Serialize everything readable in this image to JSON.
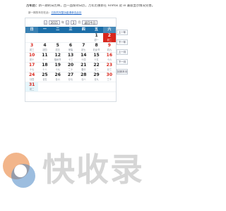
{
  "intro": {
    "bold": "万年历：",
    "text": "新一期的日历将，且一品保持日历，万年历重新在 Firefox 及 ie 兼容显示情况完善。"
  },
  "sub": {
    "prefix": "新一期的年历在此：",
    "link": "日历的完整功能请单击此处"
  },
  "controls": {
    "year": "2015",
    "year_suffix": "年",
    "month": "3",
    "month_suffix": "月",
    "back_today": "返回今日"
  },
  "weekdays": [
    "日",
    "一",
    "二",
    "三",
    "四",
    "五",
    "六"
  ],
  "days": [
    {
      "d": "",
      "l": ""
    },
    {
      "d": "",
      "l": ""
    },
    {
      "d": "",
      "l": ""
    },
    {
      "d": "",
      "l": ""
    },
    {
      "d": "",
      "l": ""
    },
    {
      "d": "1",
      "l": "初一"
    },
    {
      "d": "2",
      "l": "初二"
    },
    {
      "d": "3",
      "l": "初三"
    },
    {
      "d": "4",
      "l": "初四"
    },
    {
      "d": "5",
      "l": "初五"
    },
    {
      "d": "6",
      "l": "惊蛰"
    },
    {
      "d": "7",
      "l": "初七"
    },
    {
      "d": "8",
      "l": "妇女节"
    },
    {
      "d": "9",
      "l": "初九"
    },
    {
      "d": "10",
      "l": "初十"
    },
    {
      "d": "11",
      "l": "十一"
    },
    {
      "d": "12",
      "l": "植树节"
    },
    {
      "d": "13",
      "l": "十三"
    },
    {
      "d": "14",
      "l": "十四"
    },
    {
      "d": "15",
      "l": "十五"
    },
    {
      "d": "16",
      "l": "十六"
    },
    {
      "d": "17",
      "l": "十七"
    },
    {
      "d": "18",
      "l": "十八"
    },
    {
      "d": "19",
      "l": "十九"
    },
    {
      "d": "20",
      "l": "二十"
    },
    {
      "d": "21",
      "l": "春分"
    },
    {
      "d": "22",
      "l": "廿二"
    },
    {
      "d": "23",
      "l": "廿三"
    },
    {
      "d": "24",
      "l": "廿四"
    },
    {
      "d": "25",
      "l": "廿五"
    },
    {
      "d": "26",
      "l": "廿六"
    },
    {
      "d": "27",
      "l": "廿七"
    },
    {
      "d": "28",
      "l": "廿八"
    },
    {
      "d": "29",
      "l": "廿九"
    },
    {
      "d": "30",
      "l": "三十"
    },
    {
      "d": "31",
      "l": "初二"
    },
    {
      "d": "",
      "l": ""
    },
    {
      "d": "",
      "l": ""
    },
    {
      "d": "",
      "l": ""
    },
    {
      "d": "",
      "l": ""
    },
    {
      "d": "",
      "l": ""
    },
    {
      "d": "",
      "l": ""
    }
  ],
  "today": "2",
  "side_buttons": [
    "上一年",
    "下一年",
    "上一月",
    "下一月",
    "回到本月"
  ],
  "watermark": "快收录",
  "colors": {
    "header": "#1c6ea8",
    "today": "#d9261c",
    "highlight": "#e6f6fb"
  }
}
